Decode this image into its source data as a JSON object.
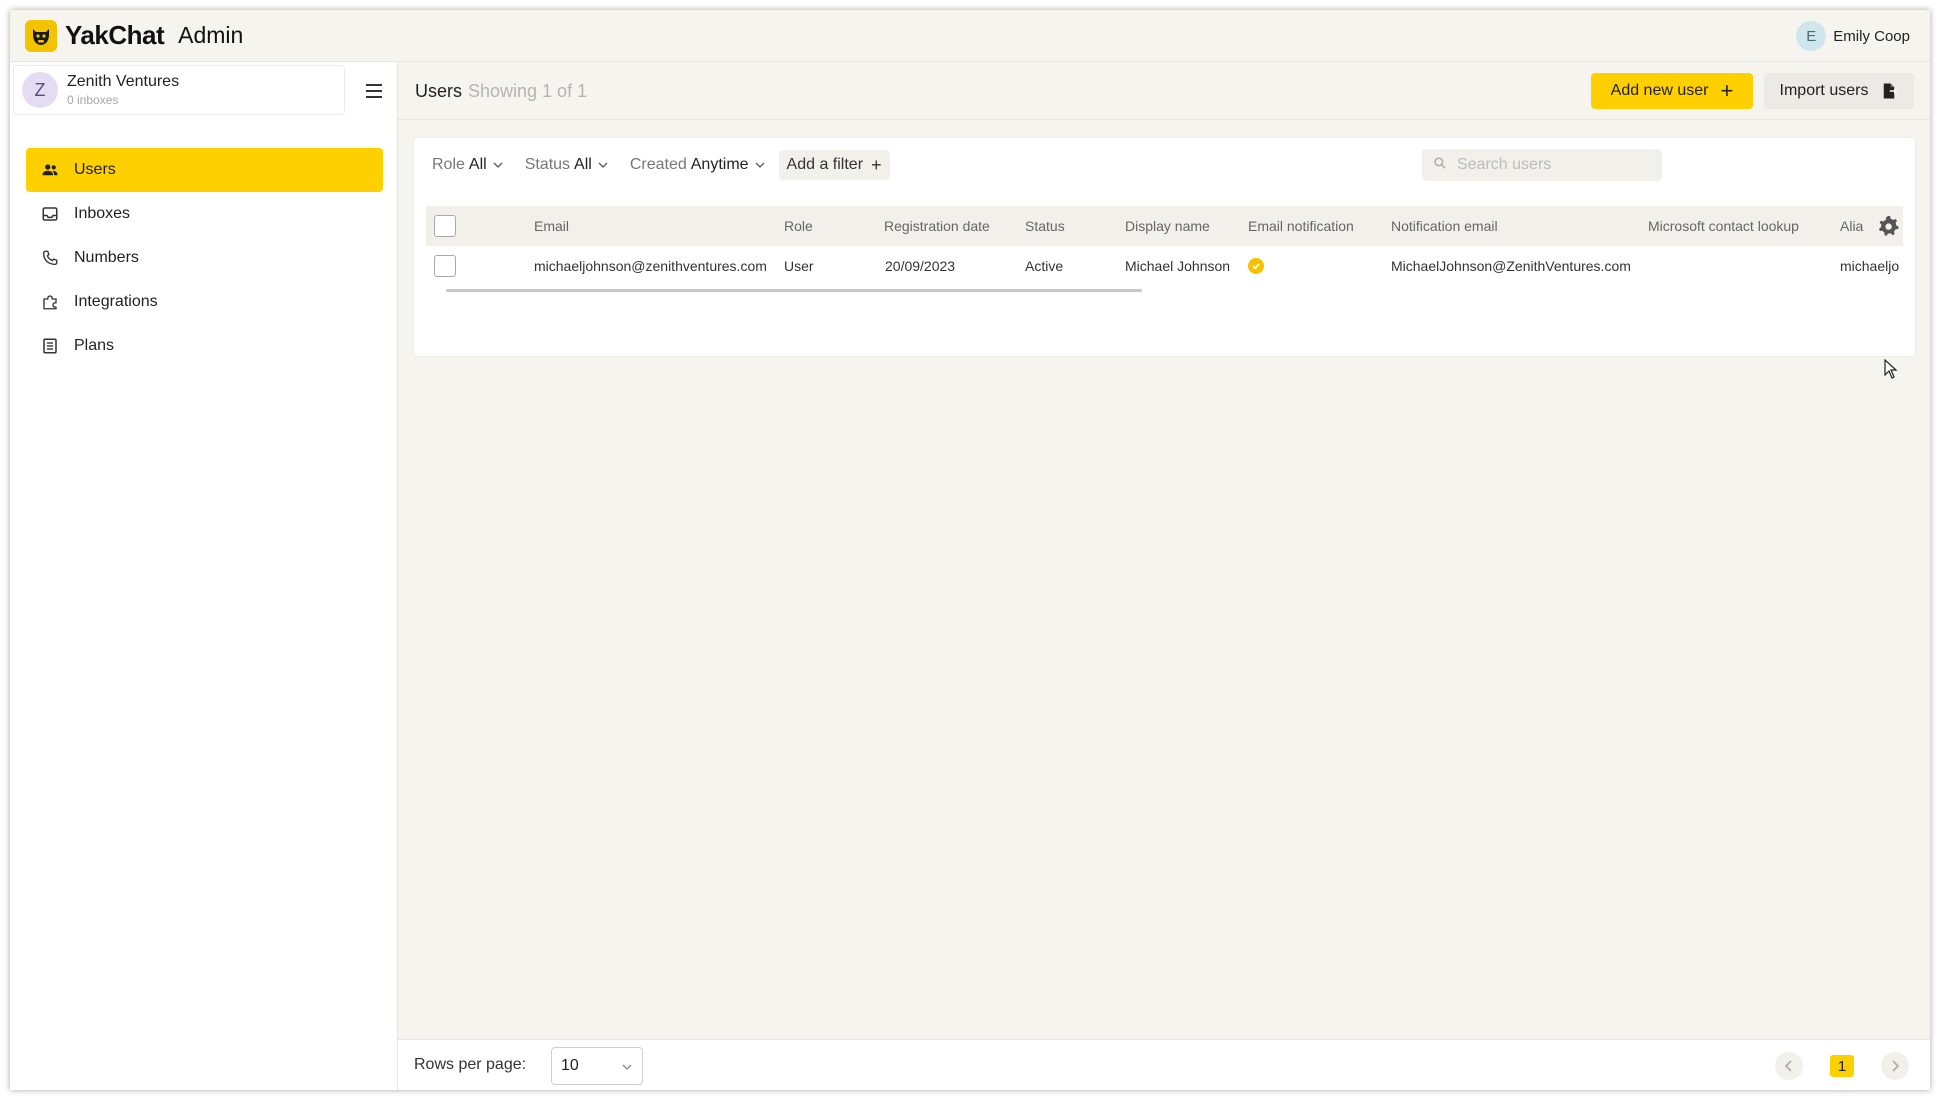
{
  "app": {
    "brand": "YakChat",
    "section": "Admin"
  },
  "user": {
    "initial": "E",
    "name": "Emily Coop"
  },
  "org": {
    "initial": "Z",
    "name": "Zenith Ventures",
    "subtitle": "0 inboxes"
  },
  "sidebar": {
    "items": [
      {
        "label": "Users",
        "icon": "users-icon",
        "active": true
      },
      {
        "label": "Inboxes",
        "icon": "inbox-icon",
        "active": false
      },
      {
        "label": "Numbers",
        "icon": "phone-icon",
        "active": false
      },
      {
        "label": "Integrations",
        "icon": "puzzle-icon",
        "active": false
      },
      {
        "label": "Plans",
        "icon": "list-icon",
        "active": false
      }
    ]
  },
  "header": {
    "title": "Users",
    "subtitle": "Showing 1 of 1",
    "add_button": "Add new user",
    "import_button": "Import users"
  },
  "filters": {
    "role_label": "Role",
    "role_value": "All",
    "status_label": "Status",
    "status_value": "All",
    "created_label": "Created",
    "created_value": "Anytime",
    "add_filter": "Add a filter"
  },
  "search": {
    "placeholder": "Search users"
  },
  "table": {
    "columns": {
      "email": "Email",
      "role": "Role",
      "registration_date": "Registration date",
      "status": "Status",
      "display_name": "Display name",
      "email_notification": "Email notification",
      "notification_email": "Notification email",
      "microsoft_contact_lookup": "Microsoft contact lookup",
      "alias": "Alia"
    },
    "rows": [
      {
        "email": "michaeljohnson@zenithventures.com",
        "role": "User",
        "registration_date": "20/09/2023",
        "status": "Active",
        "display_name": "Michael Johnson",
        "email_notification": true,
        "notification_email": "MichaelJohnson@ZenithVentures.com",
        "microsoft_contact_lookup": "",
        "alias": "michaeljo"
      }
    ]
  },
  "footer": {
    "rows_per_page_label": "Rows per page:",
    "rows_per_page_value": "10",
    "current_page": "1"
  },
  "colors": {
    "accent": "#ffd000",
    "background": "#f5f4ef"
  }
}
